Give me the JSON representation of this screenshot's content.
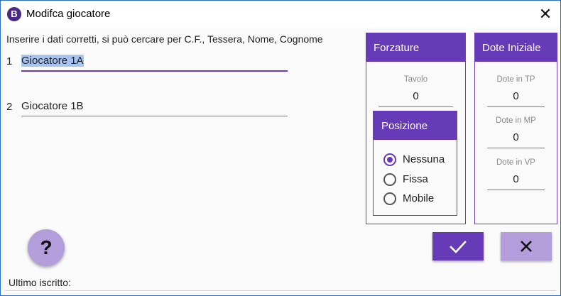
{
  "window": {
    "title": "Modifca giocatore",
    "icon_letter": "B"
  },
  "instructions": "Inserire i dati corretti, si può cercare per C.F., Tessera, Nome, Cognome",
  "players": [
    {
      "index": "1",
      "value": "Giocatore 1A"
    },
    {
      "index": "2",
      "value": "Giocatore 1B"
    }
  ],
  "forzature": {
    "title": "Forzature",
    "tavolo_label": "Tavolo",
    "tavolo_value": "0",
    "posizione": {
      "title": "Posizione",
      "options": [
        "Nessuna",
        "Fissa",
        "Mobile"
      ],
      "selected": "Nessuna"
    }
  },
  "dote": {
    "title": "Dote Iniziale",
    "fields": [
      {
        "label": "Dote in TP",
        "value": "0"
      },
      {
        "label": "Dote in MP",
        "value": "0"
      },
      {
        "label": "Dote in VP",
        "value": "0"
      }
    ]
  },
  "buttons": {
    "help": "?"
  },
  "footer": {
    "label": "Ultimo iscritto:"
  },
  "colors": {
    "accent": "#673ab7",
    "accent_light": "#b39ddb",
    "selection": "#a7c4f0"
  }
}
